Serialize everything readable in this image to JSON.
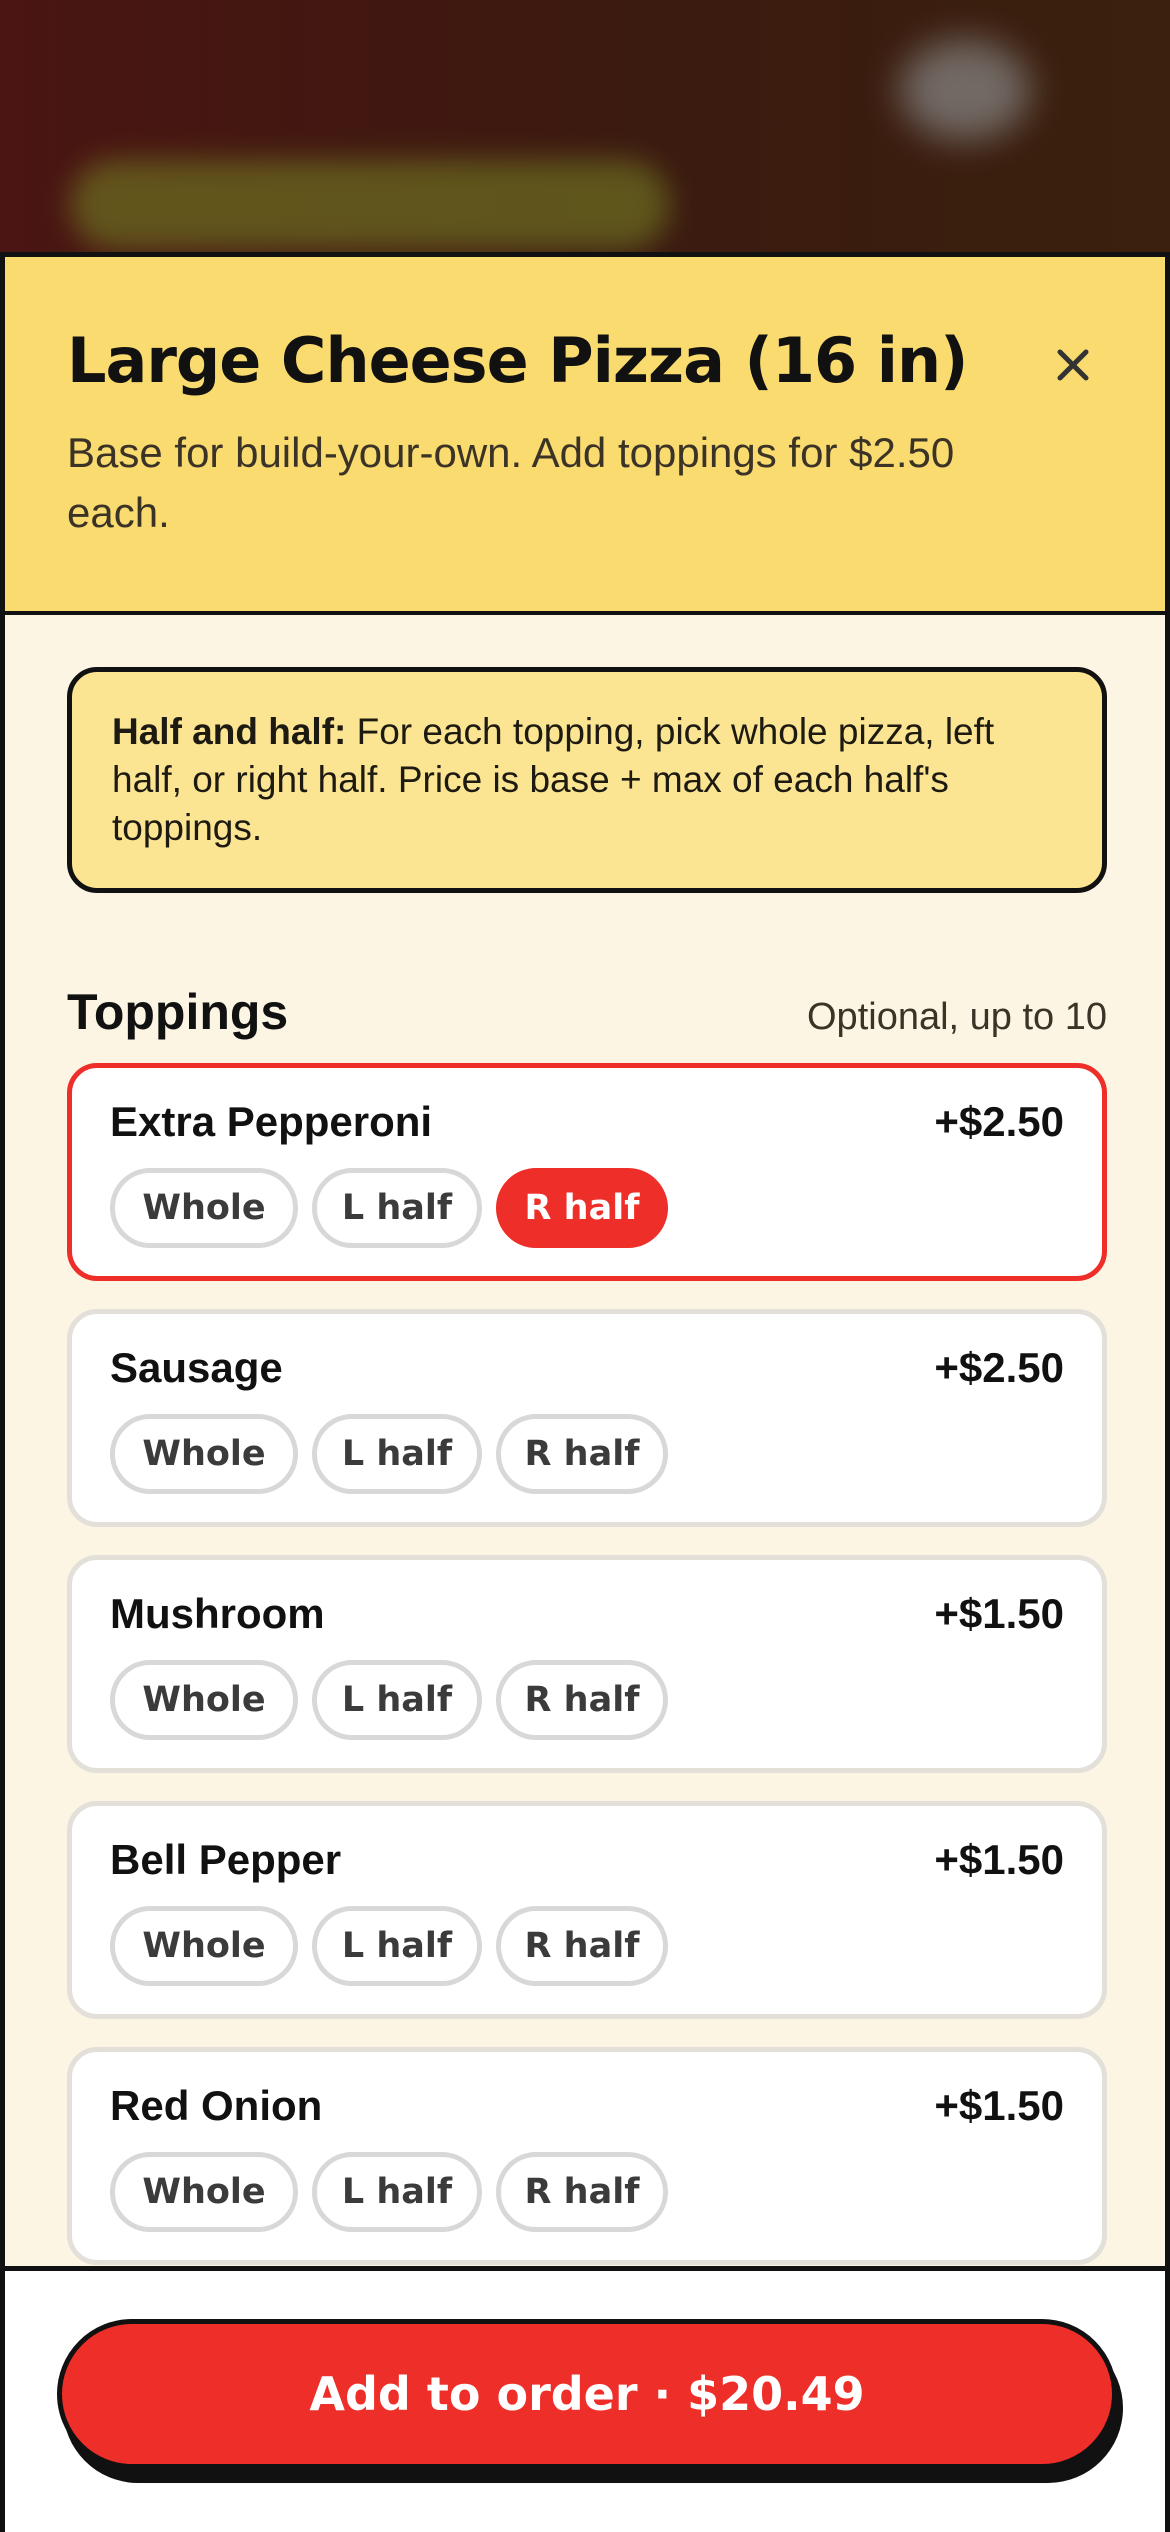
{
  "sheet": {
    "title": "Large Cheese Pizza (16 in)",
    "subtitle": "Base for build-your-own. Add toppings for $2.50 each."
  },
  "info": {
    "bold": "Half and half:",
    "text": " For each topping, pick whole pizza, left half, or right half. Price is base + max of each half's toppings."
  },
  "toppings": {
    "title": "Toppings",
    "note": "Optional, up to 10",
    "items": [
      {
        "name": "Extra Pepperoni",
        "price": "+$2.50",
        "whole": "Whole",
        "left": "L half",
        "right": "R half",
        "selected": "right"
      },
      {
        "name": "Sausage",
        "price": "+$2.50",
        "whole": "Whole",
        "left": "L half",
        "right": "R half",
        "selected": ""
      },
      {
        "name": "Mushroom",
        "price": "+$1.50",
        "whole": "Whole",
        "left": "L half",
        "right": "R half",
        "selected": ""
      },
      {
        "name": "Bell Pepper",
        "price": "+$1.50",
        "whole": "Whole",
        "left": "L half",
        "right": "R half",
        "selected": ""
      },
      {
        "name": "Red Onion",
        "price": "+$1.50",
        "whole": "Whole",
        "left": "L half",
        "right": "R half",
        "selected": ""
      }
    ]
  },
  "footer": {
    "cta_label": "Add to order · $20.49"
  },
  "colors": {
    "accent": "#ee2e28",
    "header_bg": "#fadb6f",
    "info_bg": "#fbe593",
    "sheet_bg": "#fdf5e4"
  }
}
